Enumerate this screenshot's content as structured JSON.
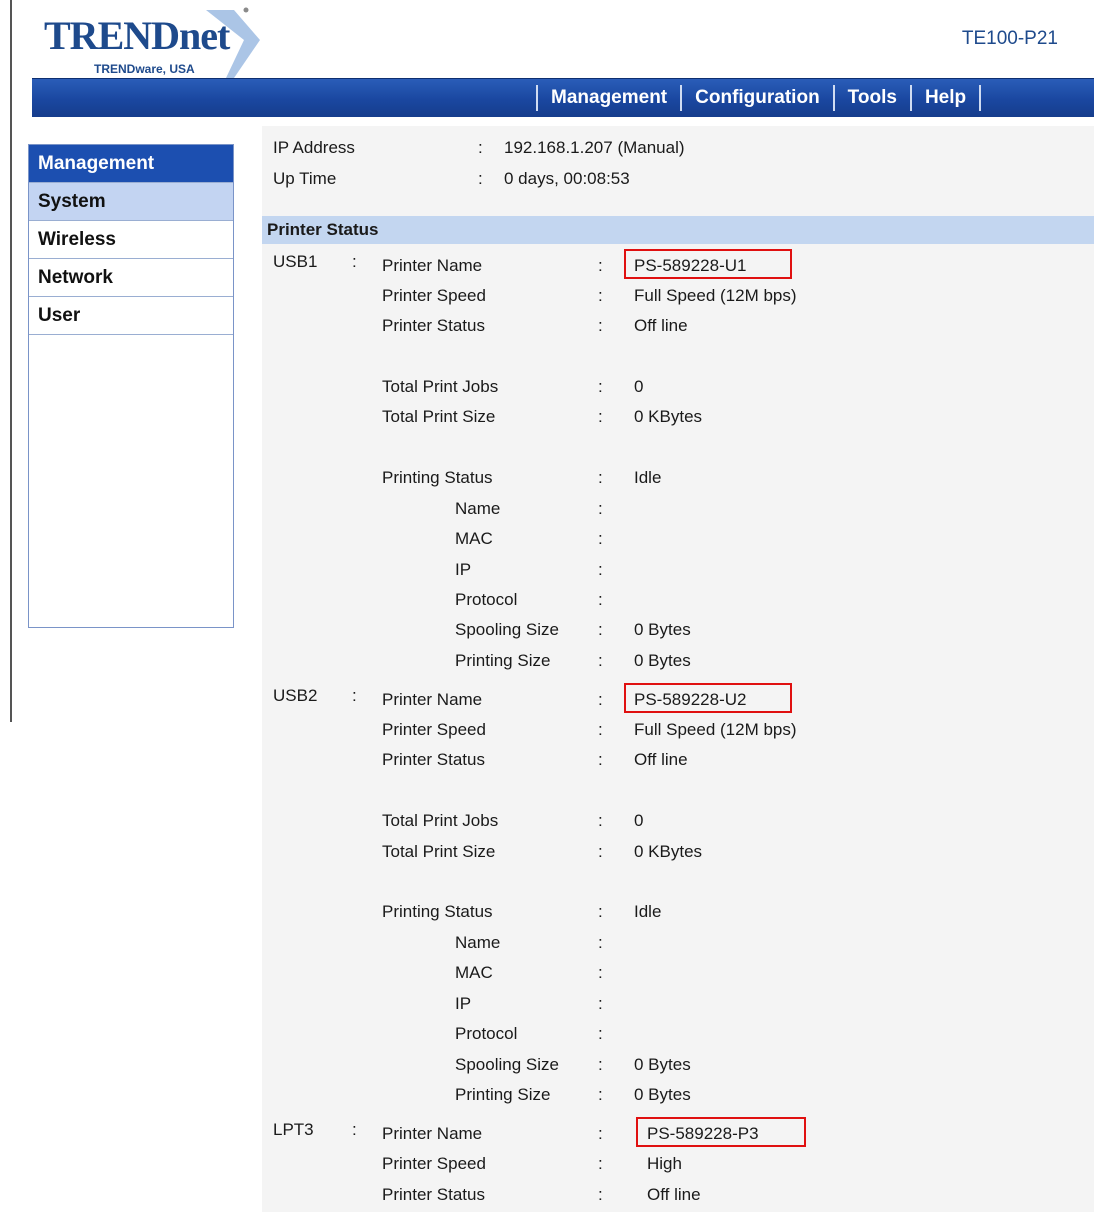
{
  "brand": {
    "logo": "TRENDnet",
    "tagline": "TRENDware, USA",
    "model": "TE100-P21",
    "colors": {
      "navy": "#1e4a8c",
      "navbar": "#1a47a0",
      "highlight": "#e01010"
    }
  },
  "nav": {
    "items": [
      "Management",
      "Configuration",
      "Tools",
      "Help"
    ]
  },
  "sidebar": {
    "header": "Management",
    "items": [
      "System",
      "Wireless",
      "Network",
      "User"
    ],
    "active": "System"
  },
  "summary": {
    "ip_label": "IP Address",
    "ip_value": "192.168.1.207 (Manual)",
    "uptime_label": "Up Time",
    "uptime_value": "0 days, 00:08:53"
  },
  "section_title": "Printer Status",
  "ports": [
    {
      "port": "USB1",
      "printer_name": "PS-589228-U1",
      "printer_speed": "Full Speed (12M bps)",
      "printer_status": "Off line",
      "total_print_jobs": "0",
      "total_print_size": "0 KBytes",
      "printing_status": "Idle",
      "name": "",
      "mac": "",
      "ip": "",
      "protocol": "",
      "spooling_size": "0 Bytes",
      "printing_size": "0 Bytes"
    },
    {
      "port": "USB2",
      "printer_name": "PS-589228-U2",
      "printer_speed": "Full Speed (12M bps)",
      "printer_status": "Off line",
      "total_print_jobs": "0",
      "total_print_size": "0 KBytes",
      "printing_status": "Idle",
      "name": "",
      "mac": "",
      "ip": "",
      "protocol": "",
      "spooling_size": "0 Bytes",
      "printing_size": "0 Bytes"
    },
    {
      "port": "LPT3",
      "printer_name": "PS-589228-P3",
      "printer_speed": "High",
      "printer_status": "Off line"
    }
  ],
  "labels": {
    "printer_name": "Printer Name",
    "printer_speed": "Printer Speed",
    "printer_status": "Printer Status",
    "total_print_jobs": "Total Print Jobs",
    "total_print_size": "Total Print Size",
    "printing_status": "Printing Status",
    "name": "Name",
    "mac": "MAC",
    "ip": "IP",
    "protocol": "Protocol",
    "spooling_size": "Spooling Size",
    "printing_size": "Printing Size",
    "colon": ":"
  }
}
